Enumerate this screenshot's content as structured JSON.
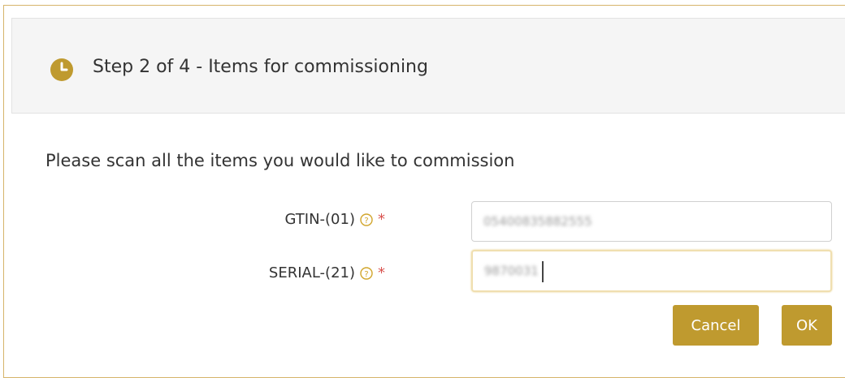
{
  "header": {
    "title": "Step 2 of 4 - Items for commissioning",
    "icon": "clock-icon",
    "icon_color": "#bf9a2f"
  },
  "intro_text": "Please scan all the items you would like to commission",
  "fields": {
    "gtin": {
      "label": "GTIN-(01)",
      "required_mark": "*",
      "value": "05400835882555"
    },
    "serial": {
      "label": "SERIAL-(21)",
      "required_mark": "*",
      "value": "9870031"
    }
  },
  "buttons": {
    "cancel_label": "Cancel",
    "ok_label": "OK",
    "color": "#bf9a2f"
  }
}
